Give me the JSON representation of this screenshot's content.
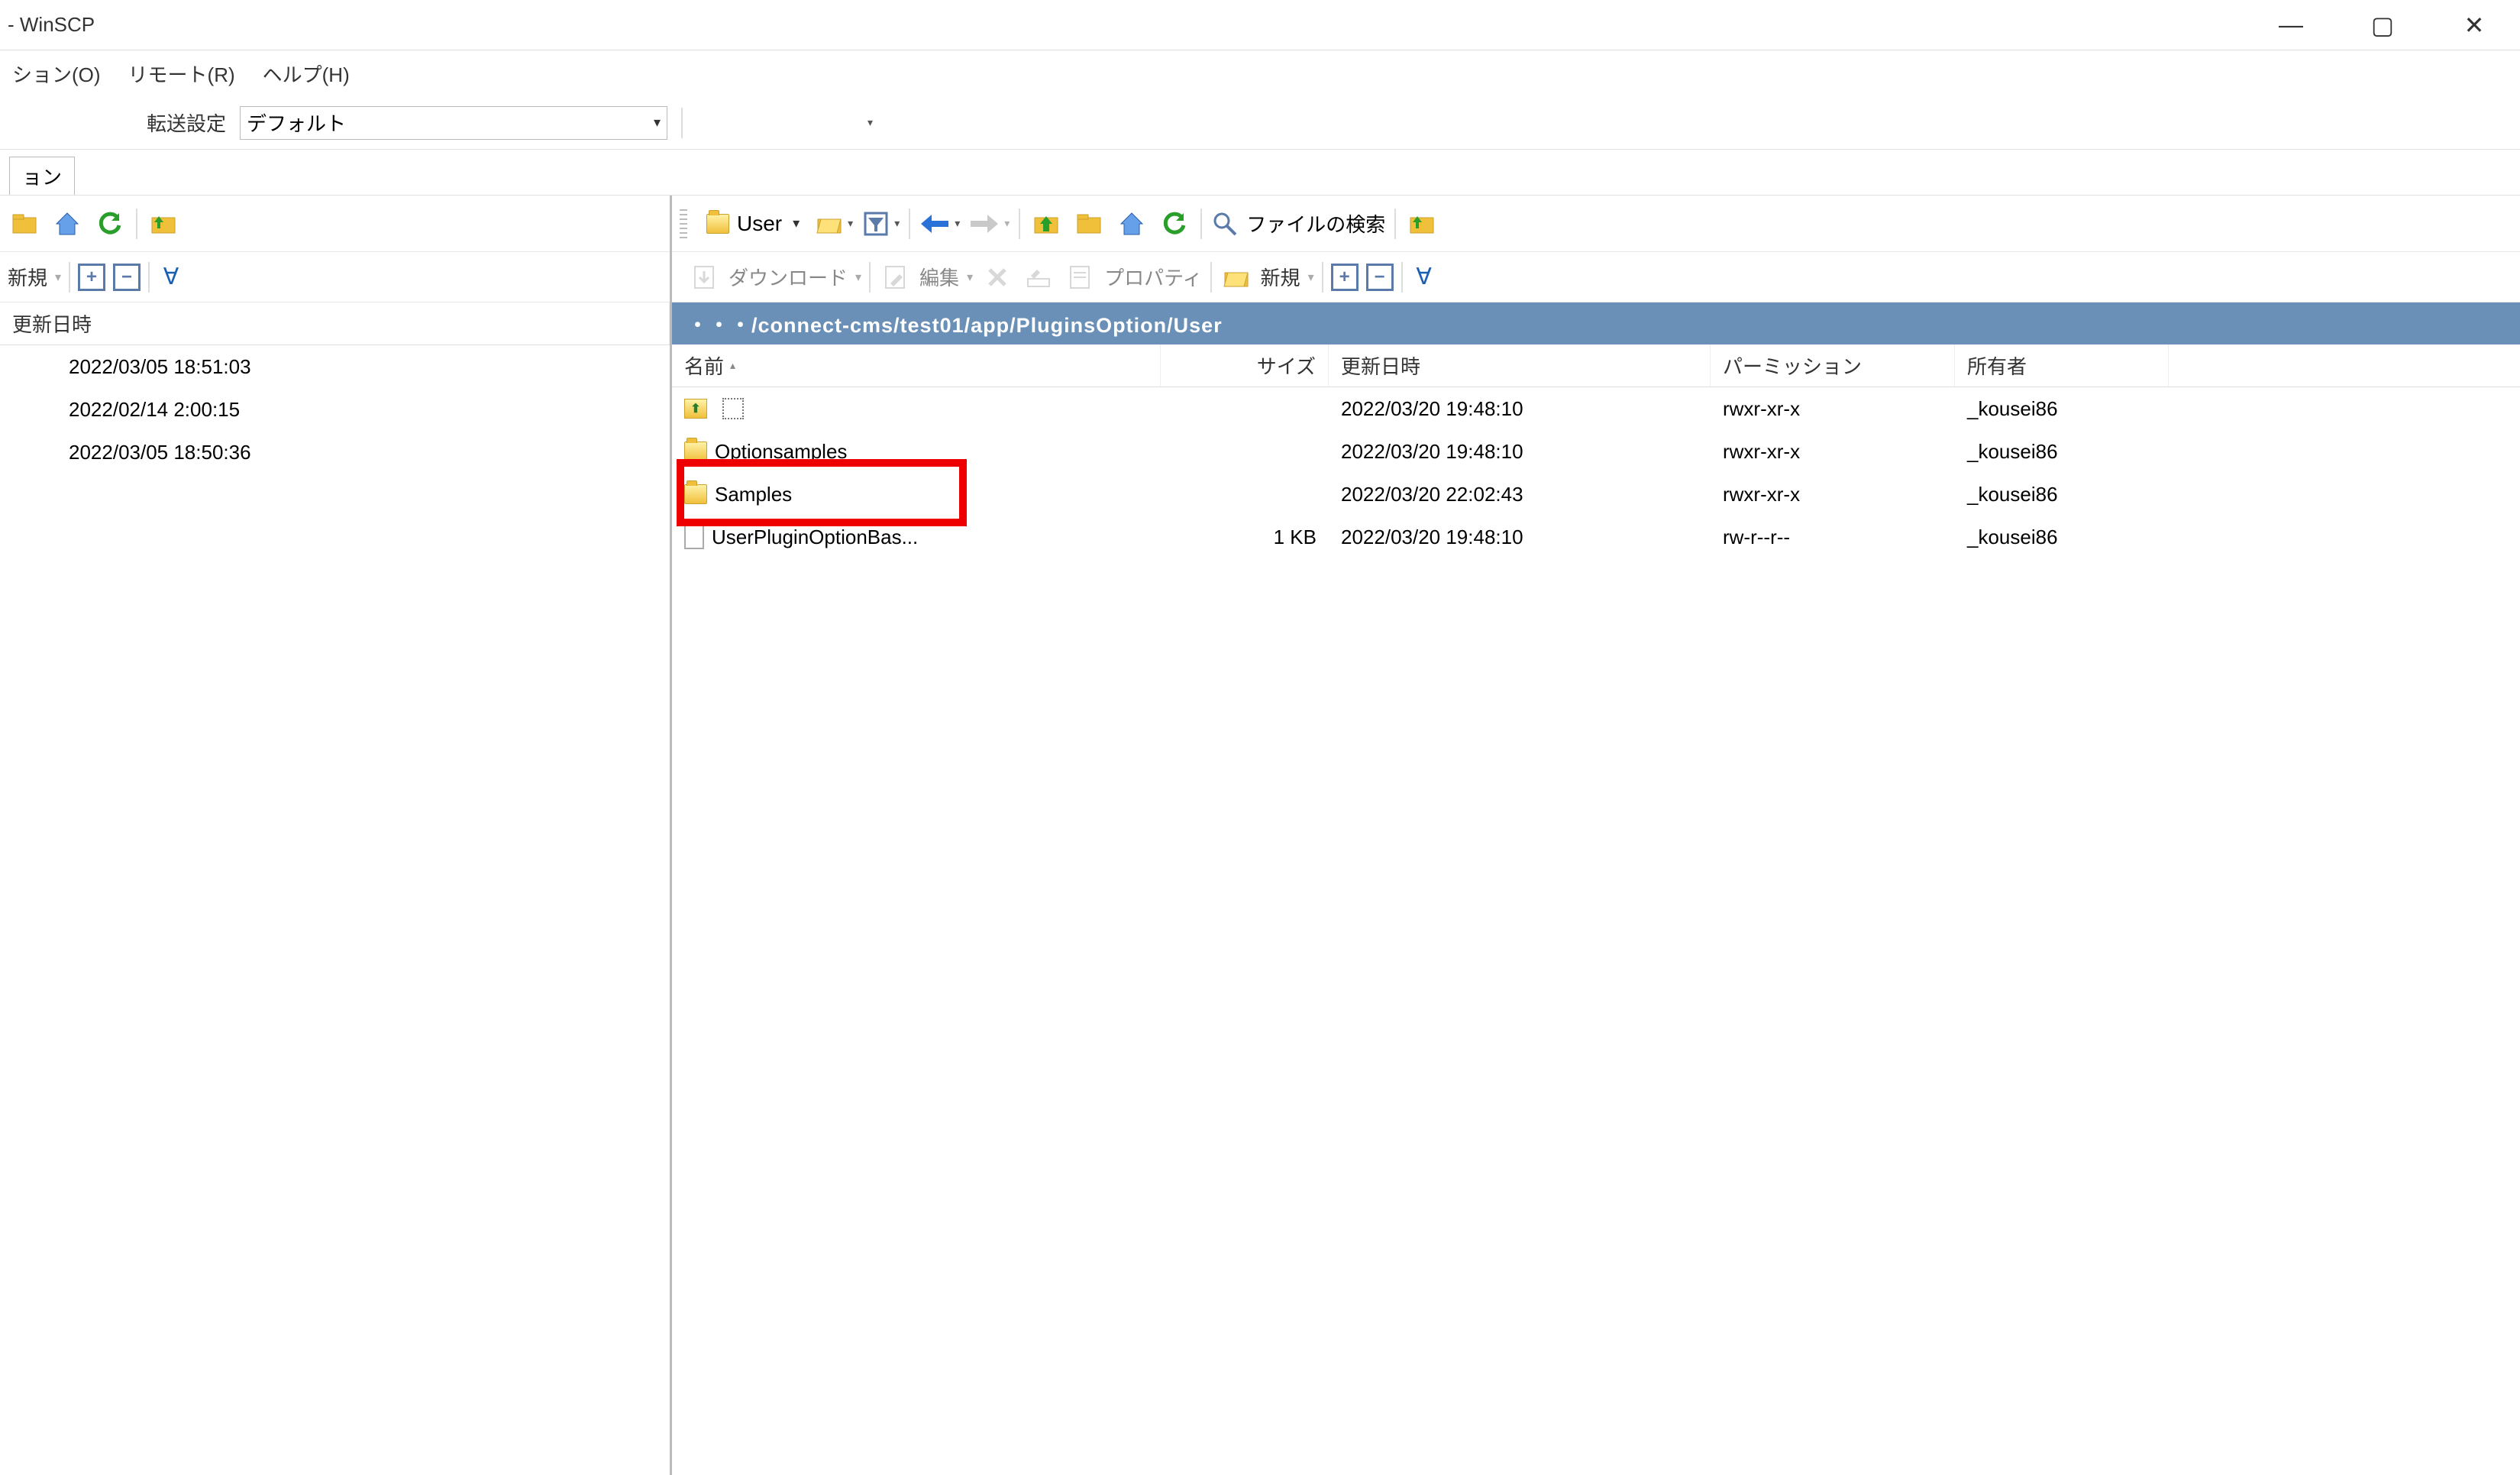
{
  "title_suffix": " - WinSCP",
  "menu": {
    "option": "ション(O)",
    "remote": "リモート(R)",
    "help": "ヘルプ(H)"
  },
  "transfer_settings_label": "転送設定",
  "transfer_preset": "デフォルト",
  "session_tab_suffix": "ョン",
  "left_panel": {
    "columns": {
      "date": "更新日時"
    },
    "new_label": "新規",
    "rows": [
      {
        "date": "2022/03/05  18:51:03"
      },
      {
        "date": "2022/02/14  2:00:15"
      },
      {
        "date": "2022/03/05  18:50:36"
      }
    ]
  },
  "right_panel": {
    "folder_dropdown": "User",
    "download_label": "ダウンロード",
    "edit_label": "編集",
    "properties_label": "プロパティ",
    "new_label": "新規",
    "search_label": "ファイルの検索",
    "path": "・・・/connect-cms/test01/app/PluginsOption/User",
    "columns": {
      "name": "名前",
      "size": "サイズ",
      "date": "更新日時",
      "perm": "パーミッション",
      "owner": "所有者"
    },
    "rows": [
      {
        "type": "up",
        "name": "..",
        "size": "",
        "date": "2022/03/20 19:48:10",
        "perm": "rwxr-xr-x",
        "owner": "_kousei86"
      },
      {
        "type": "folder",
        "name": "Optionsamples",
        "size": "",
        "date": "2022/03/20 19:48:10",
        "perm": "rwxr-xr-x",
        "owner": "_kousei86"
      },
      {
        "type": "folder",
        "name": "Samples",
        "size": "",
        "date": "2022/03/20 22:02:43",
        "perm": "rwxr-xr-x",
        "owner": "_kousei86",
        "highlighted": true
      },
      {
        "type": "file",
        "name": "UserPluginOptionBas...",
        "size": "1 KB",
        "date": "2022/03/20 19:48:10",
        "perm": "rw-r--r--",
        "owner": "_kousei86"
      }
    ]
  }
}
